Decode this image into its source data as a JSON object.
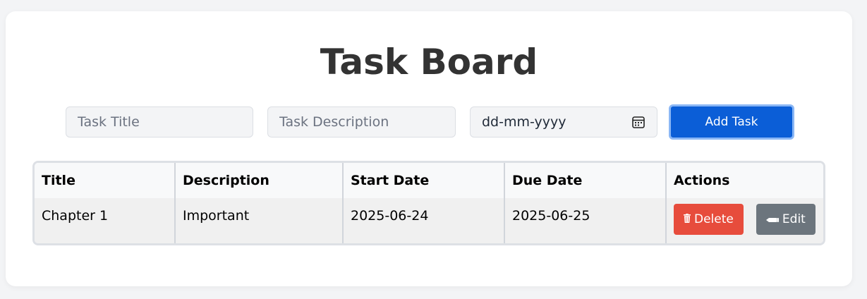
{
  "header": {
    "title": "Task Board"
  },
  "form": {
    "title_placeholder": "Task Title",
    "description_placeholder": "Task Description",
    "date_placeholder": "dd-mm-yyyy",
    "add_label": "Add Task"
  },
  "table": {
    "columns": [
      "Title",
      "Description",
      "Start Date",
      "Due Date",
      "Actions"
    ],
    "rows": [
      {
        "title": "Chapter 1",
        "description": "Important",
        "start_date": "2025-06-24",
        "due_date": "2025-06-25",
        "delete_label": "Delete",
        "delete_icon": "trash-icon",
        "edit_label": "Edit",
        "edit_icon": "pencil-icon"
      }
    ]
  },
  "colors": {
    "accent": "#0b5ed7",
    "delete": "#e74c3c",
    "edit": "#6c757d"
  }
}
